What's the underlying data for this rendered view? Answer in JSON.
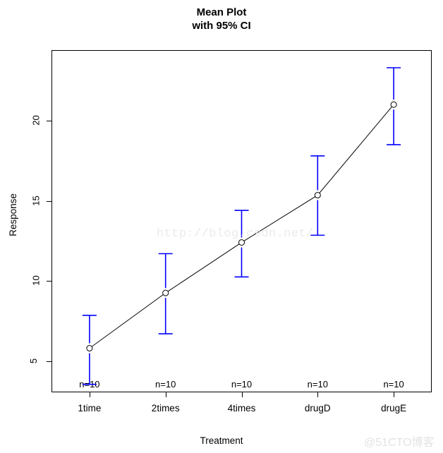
{
  "chart_data": {
    "type": "line",
    "title": "Mean Plot",
    "subtitle": "with 95% CI",
    "xlabel": "Treatment",
    "ylabel": "Response",
    "categories": [
      "1time",
      "2times",
      "4times",
      "drugD",
      "drugE"
    ],
    "values": [
      5.8,
      9.25,
      12.4,
      15.35,
      21.0
    ],
    "ci_lower": [
      3.55,
      6.7,
      10.25,
      12.85,
      18.5
    ],
    "ci_upper": [
      7.85,
      11.7,
      14.4,
      17.8,
      23.3
    ],
    "point_labels": [
      "n=10",
      "n=10",
      "n=10",
      "n=10",
      "n=10"
    ],
    "ytick_labels": [
      "5",
      "10",
      "15",
      "20"
    ],
    "ytick_values": [
      5,
      10,
      15,
      20
    ],
    "ylim": [
      3.05,
      24.4
    ],
    "xlim": [
      0.5,
      5.5
    ],
    "grid": false,
    "legend": null,
    "line_color": "#000000",
    "errorbar_color": "#0000ff",
    "marker": "open-circle"
  },
  "watermarks": {
    "url": "http://blog.csdn.net/",
    "brand": "@51CTO博客"
  }
}
